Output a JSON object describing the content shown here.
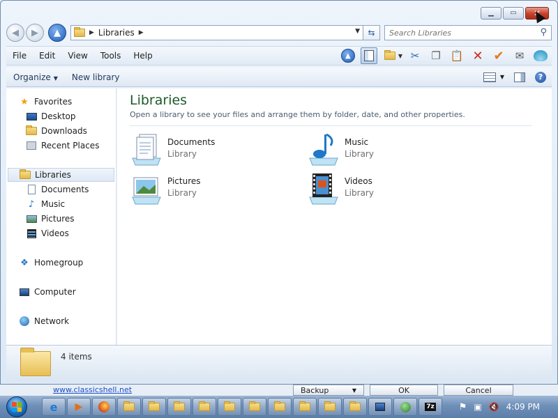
{
  "address": {
    "crumb": "Libraries"
  },
  "search": {
    "placeholder": "Search Libraries"
  },
  "menu": [
    "File",
    "Edit",
    "View",
    "Tools",
    "Help"
  ],
  "commands": {
    "organize": "Organize",
    "new_library": "New library"
  },
  "nav": {
    "favorites": "Favorites",
    "desktop": "Desktop",
    "downloads": "Downloads",
    "recent": "Recent Places",
    "libraries": "Libraries",
    "documents": "Documents",
    "music": "Music",
    "pictures": "Pictures",
    "videos": "Videos",
    "homegroup": "Homegroup",
    "computer": "Computer",
    "network": "Network"
  },
  "content": {
    "title": "Libraries",
    "description": "Open a library to see your files and arrange them by folder, date, and other properties.",
    "items": [
      {
        "name": "Documents",
        "type": "Library"
      },
      {
        "name": "Music",
        "type": "Library"
      },
      {
        "name": "Pictures",
        "type": "Library"
      },
      {
        "name": "Videos",
        "type": "Library"
      }
    ]
  },
  "details": {
    "count": "4 items"
  },
  "under": {
    "link": "www.classicshell.net",
    "backup": "Backup",
    "ok": "OK",
    "cancel": "Cancel"
  },
  "taskbar": {
    "clock": "4:09 PM"
  },
  "colors": {
    "title_green": "#1e5a2b",
    "close_red": "#c4412c",
    "taskbar_blue": "#6e8fb8"
  }
}
